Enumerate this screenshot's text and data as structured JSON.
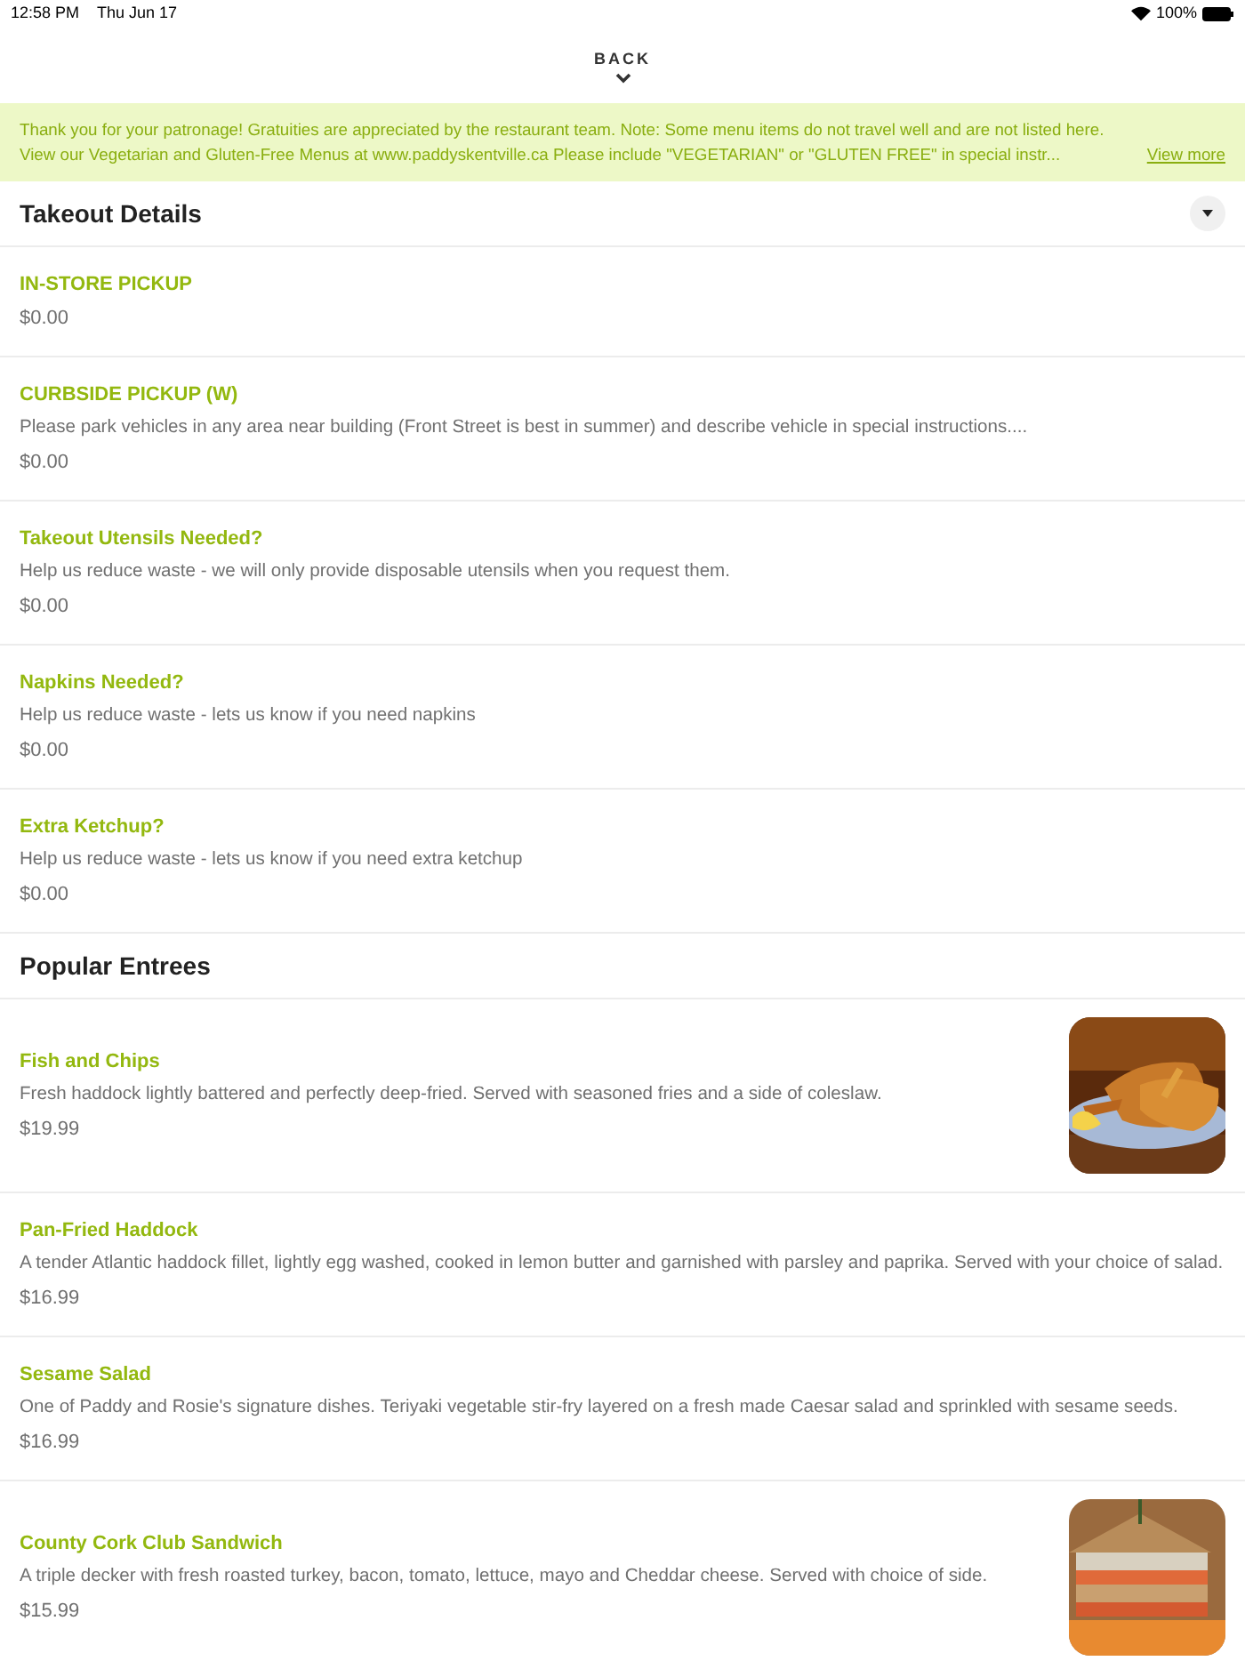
{
  "status_bar": {
    "time": "12:58 PM",
    "date": "Thu Jun 17",
    "battery": "100%"
  },
  "back": {
    "label": "BACK"
  },
  "notice": {
    "text": "Thank you for your patronage! Gratuities are appreciated by the restaurant team. Note: Some menu items do not travel well and are not listed here. View our Vegetarian and Gluten-Free Menus at www.paddyskentville.ca Please include \"VEGETARIAN\" or \"GLUTEN FREE\" in special instr...",
    "link": "View more"
  },
  "sections": [
    {
      "title": "Takeout Details",
      "collapsible": true,
      "items": [
        {
          "name": "IN-STORE PICKUP",
          "price": "$0.00"
        },
        {
          "name": "CURBSIDE PICKUP (W)",
          "description": "Please park vehicles in any area near building (Front Street is best in summer) and describe vehicle in special instructions....",
          "price": "$0.00"
        },
        {
          "name": "Takeout Utensils Needed?",
          "description": "Help us reduce waste - we will only provide disposable utensils when you request them.",
          "price": "$0.00"
        },
        {
          "name": "Napkins Needed?",
          "description": "Help us reduce waste - lets us know if you need napkins",
          "price": "$0.00"
        },
        {
          "name": "Extra Ketchup?",
          "description": "Help us reduce waste - lets us know if you need extra ketchup",
          "price": "$0.00"
        }
      ]
    },
    {
      "title": "Popular Entrees",
      "collapsible": false,
      "items": [
        {
          "name": "Fish and Chips",
          "description": "Fresh haddock lightly battered and perfectly deep-fried. Served with seasoned fries and a side of coleslaw.",
          "price": "$19.99"
        },
        {
          "name": "Pan-Fried Haddock",
          "description": "A tender Atlantic haddock fillet, lightly egg washed, cooked in lemon butter and garnished with parsley and paprika. Served with your choice of salad.",
          "price": "$16.99"
        },
        {
          "name": "Sesame Salad",
          "description": "One of Paddy and Rosie's signature dishes. Teriyaki vegetable stir-fry layered on a fresh made Caesar salad and sprinkled with sesame seeds.",
          "price": "$16.99"
        },
        {
          "name": "County Cork Club Sandwich",
          "description": "A triple decker with fresh roasted turkey, bacon, tomato, lettuce, mayo and Cheddar cheese. Served with choice of side.",
          "price": "$15.99"
        }
      ]
    }
  ]
}
